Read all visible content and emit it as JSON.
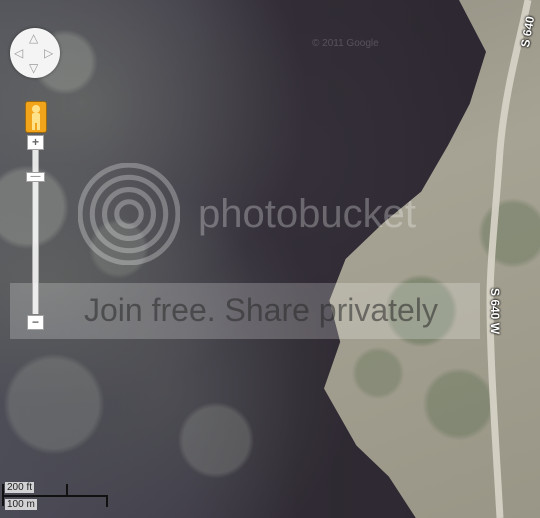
{
  "map": {
    "type": "satellite",
    "road_labels": [
      "S 640",
      "S 640 W"
    ],
    "copyright": "© 2011 Google"
  },
  "controls": {
    "pan_icons": [
      "arrow-up",
      "arrow-down",
      "arrow-left",
      "arrow-right"
    ],
    "pegman": "street-view-pegman-icon",
    "zoom_in": "+",
    "zoom_out": "−",
    "zoom_level_fraction": 0.14
  },
  "scale": {
    "imperial": "200 ft",
    "metric": "100 m"
  },
  "watermark": {
    "brand": "photobucket",
    "banner": "Join free. Share privately"
  },
  "colors": {
    "pegman": "#f2a51a",
    "road": "#d8d4c8"
  }
}
